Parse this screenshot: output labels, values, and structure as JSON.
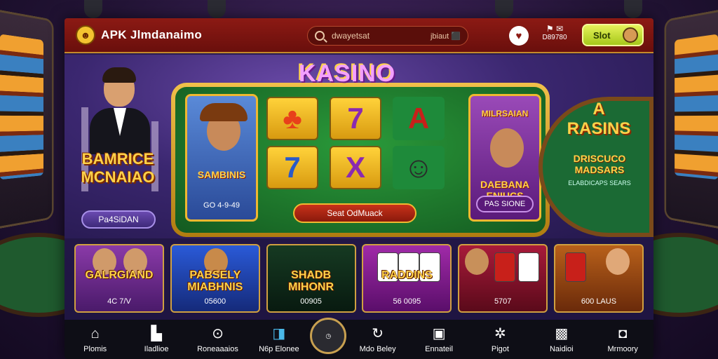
{
  "header": {
    "brand": "APK Jlmdanaimo",
    "search_text": "dwayetsat",
    "search_hint": "jbiaut ⬛",
    "badge_top": "⚑ ✉",
    "badge_bottom": "D89780",
    "start_label": "Slot"
  },
  "hero": {
    "left_title_line1": "BAMRICE",
    "left_title_line2": "MCNAIAO",
    "left_button": "Pa4SiDAN",
    "machine_title": "KASINO",
    "card1_title": "SAMBINIS",
    "card1_sub": "GO 4-9-49",
    "card2_top": "MILRSAIAN",
    "card2_title": "DAEBANA ENIUCS",
    "card2_button": "PAS SIONE",
    "spin_button": "Seat OdMuack",
    "reels": [
      "♣",
      "7",
      "A",
      "7",
      "X",
      "☺"
    ],
    "right_badge": "A RASINS",
    "right_title": "DRISCUCO MADSARS",
    "right_sub": "ELABDICAPS SEARS"
  },
  "tiles": [
    {
      "title": "GALRGIAND",
      "value": "4C 7/V",
      "bg": "#6a2a8a"
    },
    {
      "title": "PABSELY MIABHNIS",
      "value": "05600",
      "bg": "#1a3a9a"
    },
    {
      "title": "SHADB MIHONR",
      "value": "00905",
      "bg": "#0d2a1a"
    },
    {
      "title": "RADDINS",
      "value": "56 0095",
      "bg": "#7a1a7a"
    },
    {
      "title": "",
      "value": "5707",
      "bg": "#8a1a2a"
    },
    {
      "title": "",
      "value": "600 LAUS",
      "bg": "#7a3a10"
    }
  ],
  "nav": [
    {
      "label": "Plomis",
      "icon": "home-icon",
      "glyph": "⌂"
    },
    {
      "label": "Iladlioe",
      "icon": "chart-icon",
      "glyph": "▙"
    },
    {
      "label": "Roneaaaios",
      "icon": "search-icon",
      "glyph": "⊙"
    },
    {
      "label": "N6p Elonee",
      "icon": "chat-icon",
      "glyph": "◨"
    },
    {
      "label": "Mdo Beley",
      "icon": "refresh-icon",
      "glyph": "↻"
    },
    {
      "label": "Ennateil",
      "icon": "wallet-icon",
      "glyph": "▣"
    },
    {
      "label": "Pigot",
      "icon": "gear-icon",
      "glyph": "✲"
    },
    {
      "label": "Naidioi",
      "icon": "gamepad-icon",
      "glyph": "▩"
    },
    {
      "label": "Mrmoory",
      "icon": "memory-icon",
      "glyph": "◘"
    }
  ]
}
